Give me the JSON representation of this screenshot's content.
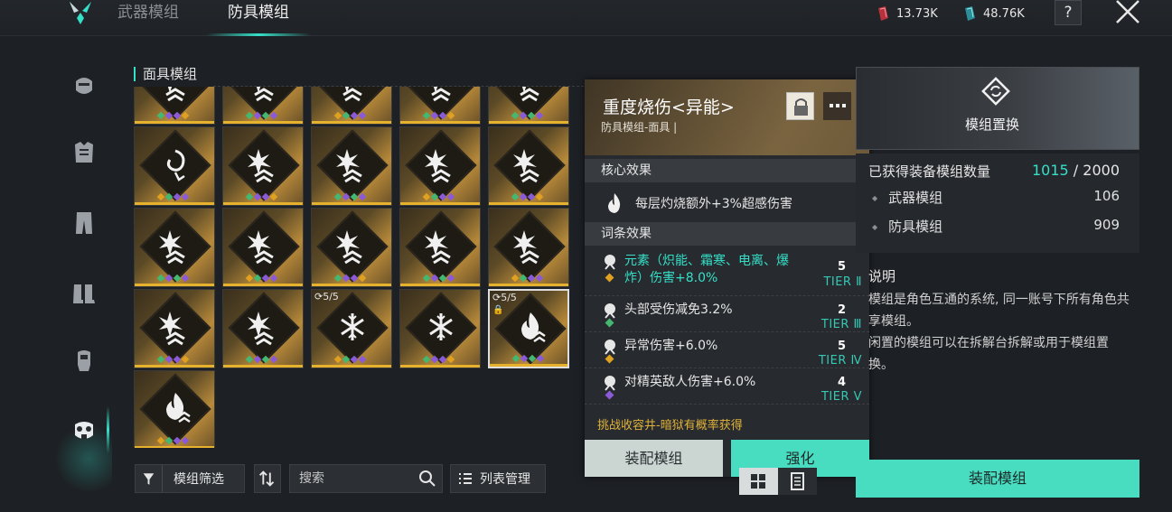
{
  "tabs": {
    "weapon": "武器模组",
    "armor": "防具模组"
  },
  "currency": [
    {
      "icon": "red-crystal-icon",
      "value": "13.73K"
    },
    {
      "icon": "teal-crystal-icon",
      "value": "48.76K"
    }
  ],
  "header_buttons": {
    "help": "?"
  },
  "sidebar": {
    "items": [
      "mask-icon",
      "chest-armor-icon",
      "pants-icon",
      "boots-icon",
      "gloves-icon",
      "gas-mask-icon"
    ],
    "active": "gas-mask-icon"
  },
  "section": {
    "title": "面具模组"
  },
  "mods": [
    {
      "row": 0,
      "col": 0,
      "icon": "burst-icon"
    },
    {
      "row": 0,
      "col": 1,
      "icon": "burst-icon"
    },
    {
      "row": 0,
      "col": 2,
      "icon": "burst-icon"
    },
    {
      "row": 0,
      "col": 3,
      "icon": "burst-icon"
    },
    {
      "row": 0,
      "col": 4,
      "icon": "burst-icon"
    },
    {
      "row": 1,
      "col": 0,
      "icon": "swirl-icon"
    },
    {
      "row": 1,
      "col": 1,
      "icon": "burst-icon"
    },
    {
      "row": 1,
      "col": 2,
      "icon": "burst-icon"
    },
    {
      "row": 1,
      "col": 3,
      "icon": "burst-icon"
    },
    {
      "row": 1,
      "col": 4,
      "icon": "burst-icon"
    },
    {
      "row": 2,
      "col": 0,
      "icon": "burst-icon"
    },
    {
      "row": 2,
      "col": 1,
      "icon": "burst-icon"
    },
    {
      "row": 2,
      "col": 2,
      "icon": "burst-icon"
    },
    {
      "row": 2,
      "col": 3,
      "icon": "burst-icon"
    },
    {
      "row": 2,
      "col": 4,
      "icon": "burst-icon"
    },
    {
      "row": 3,
      "col": 0,
      "icon": "burst-icon"
    },
    {
      "row": 3,
      "col": 1,
      "icon": "burst-icon"
    },
    {
      "row": 3,
      "col": 2,
      "icon": "snowflake-icon",
      "badge": "5/5"
    },
    {
      "row": 3,
      "col": 3,
      "icon": "snowflake-icon"
    },
    {
      "row": 3,
      "col": 4,
      "icon": "flame-icon",
      "badge": "5/5",
      "locked": true,
      "selected": true
    },
    {
      "row": 4,
      "col": 0,
      "icon": "flame-icon"
    }
  ],
  "popup": {
    "title": "重度烧伤<异能>",
    "subtitle": "防具模组-面具 |",
    "core_label": "核心效果",
    "core_effect": "每层灼烧额外+3%超感伤害",
    "affix_label": "词条效果",
    "affixes": [
      {
        "text": "元素（炽能、霜寒、电离、爆炸）伤害+8.0%",
        "value": "5",
        "tier": "TIER Ⅱ",
        "highlight": true,
        "icon": "element-icon",
        "dot": "#e0a020"
      },
      {
        "text": "头部受伤减免3.2%",
        "value": "2",
        "tier": "TIER Ⅲ",
        "highlight": false,
        "icon": "head-icon",
        "dot": "#44b870"
      },
      {
        "text": "异常伤害+6.0%",
        "value": "5",
        "tier": "TIER Ⅳ",
        "highlight": false,
        "icon": "status-icon",
        "dot": "#e0a020"
      },
      {
        "text": "对精英敌人伤害+6.0%",
        "value": "4",
        "tier": "TIER Ⅴ",
        "highlight": false,
        "icon": "elite-icon",
        "dot": "#8a5ad8"
      }
    ],
    "source": "挑战收容井-暗狱有概率获得",
    "equip_button": "装配模组",
    "enhance_button": "强化"
  },
  "banner": {
    "label": "模组置换"
  },
  "stats": {
    "label": "已获得装备模组数量",
    "owned": "1015",
    "total": "/ 2000",
    "rows": [
      {
        "label": "武器模组",
        "value": "106"
      },
      {
        "label": "防具模组",
        "value": "909"
      }
    ]
  },
  "desc": {
    "title": "说明",
    "text1": "模组是角色互通的系统, 同一账号下所有角色共享模组。",
    "text2": "闲置的模组可以在拆解台拆解或用于模组置换。"
  },
  "footer": {
    "filter": "模组筛选",
    "search_placeholder": "搜索",
    "list_manage": "列表管理",
    "equip_button": "装配模组"
  },
  "colors": {
    "accent": "#36e0c8",
    "gold": "#e6b12c"
  }
}
